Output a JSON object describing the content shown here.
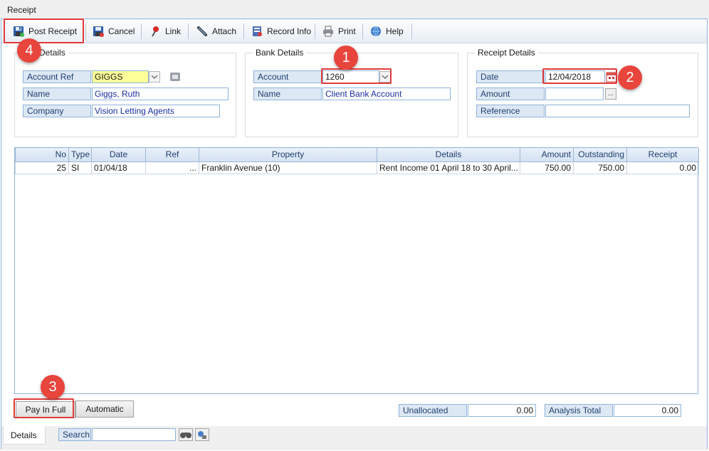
{
  "window": {
    "title": "Receipt"
  },
  "toolbar": {
    "post_receipt": "Post Receipt",
    "cancel": "Cancel",
    "link": "Link",
    "attach": "Attach",
    "record_info": "Record Info",
    "print": "Print",
    "help": "Help"
  },
  "client_details": {
    "legend": "ent Details",
    "account_ref_label": "Account Ref",
    "account_ref_value": "GIGGS",
    "name_label": "Name",
    "name_value": "Giggs, Ruth",
    "company_label": "Company",
    "company_value": "Vision Letting Agents"
  },
  "bank_details": {
    "legend": "Bank Details",
    "account_label": "Account",
    "account_value": "1260",
    "name_label": "Name",
    "name_value": "Client Bank Account"
  },
  "receipt_details": {
    "legend": "Receipt Details",
    "date_label": "Date",
    "date_value": "12/04/2018",
    "amount_label": "Amount",
    "amount_value": "",
    "reference_label": "Reference",
    "reference_value": ""
  },
  "table": {
    "columns": [
      "No",
      "Type",
      "Date",
      "Ref",
      "Property",
      "Details",
      "Amount",
      "Outstanding",
      "Receipt"
    ],
    "rows": [
      {
        "no": "25",
        "type": "SI",
        "date": "01/04/18",
        "ref": "...",
        "property": "Franklin Avenue (10)",
        "details": "Rent Income 01 April 18 to 30 April...",
        "amount": "750.00",
        "outstanding": "750.00",
        "receipt": "0.00"
      }
    ]
  },
  "footer": {
    "pay_in_full": "Pay In Full",
    "automatic": "Automatic",
    "unallocated_label": "Unallocated",
    "unallocated_value": "0.00",
    "analysis_total_label": "Analysis Total",
    "analysis_total_value": "0.00"
  },
  "bottom_bar": {
    "tab_details": "Details",
    "search_label": "Search",
    "search_value": ""
  },
  "annotations": {
    "badge1": "1",
    "badge2": "2",
    "badge3": "3",
    "badge4": "4"
  },
  "colors": {
    "highlight": "#e03a3a",
    "badge": "#e8453c",
    "label_bg": "#dde8f5",
    "field_border": "#8fb3d9",
    "account_ref_bg": "#ffff99"
  },
  "icons": [
    "save-icon",
    "cancel-icon",
    "link-pin-icon",
    "attach-icon",
    "record-info-icon",
    "printer-icon",
    "help-globe-icon",
    "calendar-icon",
    "binoculars-icon",
    "search-options-icon",
    "chevron-down-icon",
    "lookup-icon"
  ]
}
